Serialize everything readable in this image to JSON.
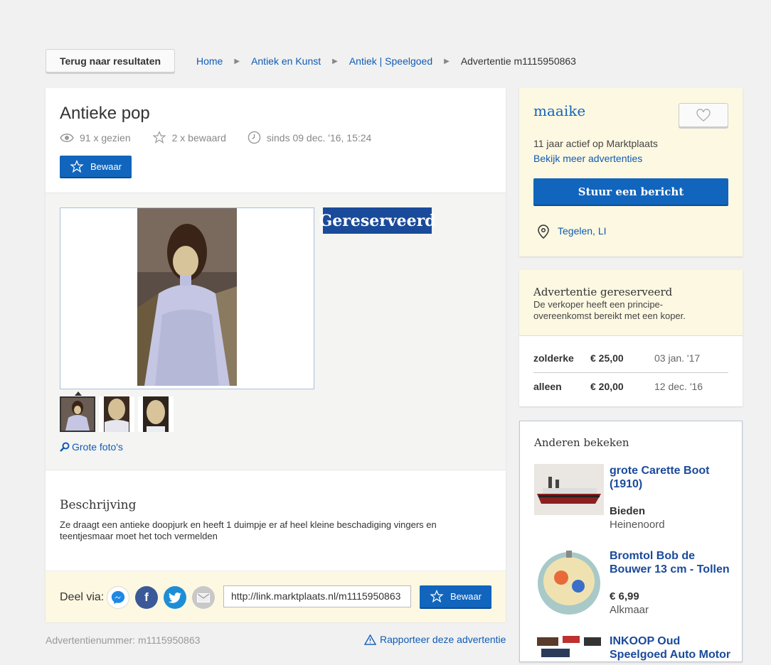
{
  "nav": {
    "back_label": "Terug naar resultaten",
    "breadcrumbs": [
      "Home",
      "Antiek en Kunst",
      "Antiek | Speelgoed",
      "Advertentie m1115950863"
    ]
  },
  "listing": {
    "title": "Antieke pop",
    "views": "91 x gezien",
    "saved": "2 x bewaard",
    "since": "sinds 09 dec. '16, 15:24",
    "save_label": "Bewaar",
    "status_badge": "Gereserveerd",
    "big_photos_label": "Grote foto's",
    "description_heading": "Beschrijving",
    "description": "Ze draagt een antieke doopjurk en heeft 1 duimpje er af  heel kleine beschadiging vingers en teentjesmaar moet het toch vermelden",
    "share_label": "Deel via:",
    "share_url": "http://link.marktplaats.nl/m1115950863",
    "share_save_label": "Bewaar",
    "ad_number": "Advertentienummer: m1115950863",
    "report_label": "Rapporteer deze advertentie"
  },
  "seller": {
    "name": "maaike",
    "active": "11 jaar actief op Marktplaats",
    "more_ads": "Bekijk meer advertenties",
    "message_button": "Stuur een bericht",
    "location": "Tegelen, LI"
  },
  "reserved": {
    "heading": "Advertentie gereserveerd",
    "text": "De verkoper heeft een principe-overeenkomst bereikt met een koper.",
    "bids": [
      {
        "name": "zolderke",
        "amount": "€ 25,00",
        "date": "03 jan. '17"
      },
      {
        "name": "alleen",
        "amount": "€ 20,00",
        "date": "12 dec. '16"
      }
    ]
  },
  "others": {
    "heading": "Anderen bekeken",
    "items": [
      {
        "title": "grote Carette Boot (1910)",
        "price": "Bieden",
        "city": "Heinenoord"
      },
      {
        "title": "Bromtol Bob de Bouwer 13 cm - Tollen",
        "price": "€ 6,99",
        "city": "Alkmaar"
      },
      {
        "title": "INKOOP Oud Speelgoed Auto Motor",
        "price": "",
        "city": ""
      }
    ]
  },
  "colors": {
    "accent": "#1165bd",
    "badge": "#1a4a9a",
    "panel_yellow": "#fdf8e1"
  }
}
